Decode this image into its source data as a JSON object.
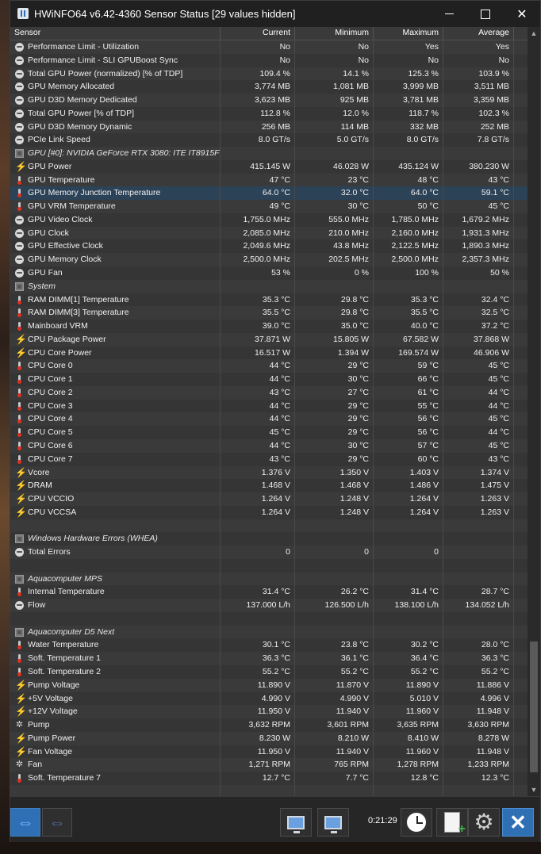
{
  "window": {
    "title": "HWiNFO64 v6.42-4360 Sensor Status [29 values hidden]"
  },
  "columns": {
    "sensor": "Sensor",
    "current": "Current",
    "minimum": "Minimum",
    "maximum": "Maximum",
    "average": "Average"
  },
  "rows": [
    {
      "type": "data",
      "icon": "clock-icon",
      "name": "Performance Limit - Utilization",
      "cur": "No",
      "min": "No",
      "max": "Yes",
      "avg": "Yes"
    },
    {
      "type": "data",
      "icon": "clock-icon",
      "name": "Performance Limit - SLI GPUBoost Sync",
      "cur": "No",
      "min": "No",
      "max": "No",
      "avg": "No"
    },
    {
      "type": "data",
      "icon": "clock-icon",
      "name": "Total GPU Power (normalized) [% of TDP]",
      "cur": "109.4 %",
      "min": "14.1 %",
      "max": "125.3 %",
      "avg": "103.9 %"
    },
    {
      "type": "data",
      "icon": "clock-icon",
      "name": "GPU Memory Allocated",
      "cur": "3,774 MB",
      "min": "1,081 MB",
      "max": "3,999 MB",
      "avg": "3,511 MB"
    },
    {
      "type": "data",
      "icon": "clock-icon",
      "name": "GPU D3D Memory Dedicated",
      "cur": "3,623 MB",
      "min": "925 MB",
      "max": "3,781 MB",
      "avg": "3,359 MB"
    },
    {
      "type": "data",
      "icon": "clock-icon",
      "name": "Total GPU Power [% of TDP]",
      "cur": "112.8 %",
      "min": "12.0 %",
      "max": "118.7 %",
      "avg": "102.3 %"
    },
    {
      "type": "data",
      "icon": "clock-icon",
      "name": "GPU D3D Memory Dynamic",
      "cur": "256 MB",
      "min": "114 MB",
      "max": "332 MB",
      "avg": "252 MB"
    },
    {
      "type": "data",
      "icon": "clock-icon",
      "name": "PCIe Link Speed",
      "cur": "8.0 GT/s",
      "min": "5.0 GT/s",
      "max": "8.0 GT/s",
      "avg": "7.8 GT/s"
    },
    {
      "type": "group",
      "icon": "chip-icon",
      "name": "GPU [#0]: NVIDIA GeForce RTX 3080: ITE IT8915FN"
    },
    {
      "type": "data",
      "icon": "bolt-icon",
      "name": "GPU Power",
      "cur": "415.145 W",
      "min": "46.028 W",
      "max": "435.124 W",
      "avg": "380.230 W"
    },
    {
      "type": "data",
      "icon": "thermometer-icon",
      "name": "GPU Temperature",
      "cur": "47 °C",
      "min": "23 °C",
      "max": "48 °C",
      "avg": "43 °C"
    },
    {
      "type": "data",
      "icon": "thermometer-icon",
      "name": "GPU Memory Junction Temperature",
      "cur": "64.0 °C",
      "min": "32.0 °C",
      "max": "64.0 °C",
      "avg": "59.1 °C",
      "selected": true
    },
    {
      "type": "data",
      "icon": "thermometer-icon",
      "name": "GPU VRM Temperature",
      "cur": "49 °C",
      "min": "30 °C",
      "max": "50 °C",
      "avg": "45 °C"
    },
    {
      "type": "data",
      "icon": "clock-icon",
      "name": "GPU Video Clock",
      "cur": "1,755.0 MHz",
      "min": "555.0 MHz",
      "max": "1,785.0 MHz",
      "avg": "1,679.2 MHz"
    },
    {
      "type": "data",
      "icon": "clock-icon",
      "name": "GPU Clock",
      "cur": "2,085.0 MHz",
      "min": "210.0 MHz",
      "max": "2,160.0 MHz",
      "avg": "1,931.3 MHz"
    },
    {
      "type": "data",
      "icon": "clock-icon",
      "name": "GPU Effective Clock",
      "cur": "2,049.6 MHz",
      "min": "43.8 MHz",
      "max": "2,122.5 MHz",
      "avg": "1,890.3 MHz"
    },
    {
      "type": "data",
      "icon": "clock-icon",
      "name": "GPU Memory Clock",
      "cur": "2,500.0 MHz",
      "min": "202.5 MHz",
      "max": "2,500.0 MHz",
      "avg": "2,357.3 MHz"
    },
    {
      "type": "data",
      "icon": "clock-icon",
      "name": "GPU Fan",
      "cur": "53 %",
      "min": "0 %",
      "max": "100 %",
      "avg": "50 %"
    },
    {
      "type": "group",
      "icon": "chip-icon",
      "name": "System"
    },
    {
      "type": "data",
      "icon": "thermometer-icon",
      "name": "RAM DIMM[1] Temperature",
      "cur": "35.3 °C",
      "min": "29.8 °C",
      "max": "35.3 °C",
      "avg": "32.4 °C"
    },
    {
      "type": "data",
      "icon": "thermometer-icon",
      "name": "RAM DIMM[3] Temperature",
      "cur": "35.5 °C",
      "min": "29.8 °C",
      "max": "35.5 °C",
      "avg": "32.5 °C"
    },
    {
      "type": "data",
      "icon": "thermometer-icon",
      "name": "Mainboard VRM",
      "cur": "39.0 °C",
      "min": "35.0 °C",
      "max": "40.0 °C",
      "avg": "37.2 °C"
    },
    {
      "type": "data",
      "icon": "bolt-icon",
      "name": "CPU Package Power",
      "cur": "37.871 W",
      "min": "15.805 W",
      "max": "67.582 W",
      "avg": "37.868 W"
    },
    {
      "type": "data",
      "icon": "bolt-icon",
      "name": "CPU Core Power",
      "cur": "16.517 W",
      "min": "1.394 W",
      "max": "169.574 W",
      "avg": "46.906 W"
    },
    {
      "type": "data",
      "icon": "thermometer-icon",
      "name": "CPU Core 0",
      "cur": "44 °C",
      "min": "29 °C",
      "max": "59 °C",
      "avg": "45 °C"
    },
    {
      "type": "data",
      "icon": "thermometer-icon",
      "name": "CPU Core 1",
      "cur": "44 °C",
      "min": "30 °C",
      "max": "66 °C",
      "avg": "45 °C"
    },
    {
      "type": "data",
      "icon": "thermometer-icon",
      "name": "CPU Core 2",
      "cur": "43 °C",
      "min": "27 °C",
      "max": "61 °C",
      "avg": "44 °C"
    },
    {
      "type": "data",
      "icon": "thermometer-icon",
      "name": "CPU Core 3",
      "cur": "44 °C",
      "min": "29 °C",
      "max": "55 °C",
      "avg": "44 °C"
    },
    {
      "type": "data",
      "icon": "thermometer-icon",
      "name": "CPU Core 4",
      "cur": "44 °C",
      "min": "29 °C",
      "max": "56 °C",
      "avg": "45 °C"
    },
    {
      "type": "data",
      "icon": "thermometer-icon",
      "name": "CPU Core 5",
      "cur": "45 °C",
      "min": "29 °C",
      "max": "56 °C",
      "avg": "44 °C"
    },
    {
      "type": "data",
      "icon": "thermometer-icon",
      "name": "CPU Core 6",
      "cur": "44 °C",
      "min": "30 °C",
      "max": "57 °C",
      "avg": "45 °C"
    },
    {
      "type": "data",
      "icon": "thermometer-icon",
      "name": "CPU Core 7",
      "cur": "43 °C",
      "min": "29 °C",
      "max": "60 °C",
      "avg": "43 °C"
    },
    {
      "type": "data",
      "icon": "bolt-icon",
      "name": "Vcore",
      "cur": "1.376 V",
      "min": "1.350 V",
      "max": "1.403 V",
      "avg": "1.374 V"
    },
    {
      "type": "data",
      "icon": "bolt-icon",
      "name": "DRAM",
      "cur": "1.468 V",
      "min": "1.468 V",
      "max": "1.486 V",
      "avg": "1.475 V"
    },
    {
      "type": "data",
      "icon": "bolt-icon",
      "name": "CPU VCCIO",
      "cur": "1.264 V",
      "min": "1.248 V",
      "max": "1.264 V",
      "avg": "1.263 V"
    },
    {
      "type": "data",
      "icon": "bolt-icon",
      "name": "CPU VCCSA",
      "cur": "1.264 V",
      "min": "1.248 V",
      "max": "1.264 V",
      "avg": "1.263 V"
    },
    {
      "type": "blank"
    },
    {
      "type": "group",
      "icon": "chip-icon",
      "name": "Windows Hardware Errors (WHEA)"
    },
    {
      "type": "data",
      "icon": "clock-icon",
      "name": "Total Errors",
      "cur": "0",
      "min": "0",
      "max": "0",
      "avg": ""
    },
    {
      "type": "blank"
    },
    {
      "type": "group",
      "icon": "chip-icon",
      "name": "Aquacomputer MPS"
    },
    {
      "type": "data",
      "icon": "thermometer-icon",
      "name": "Internal Temperature",
      "cur": "31.4 °C",
      "min": "26.2 °C",
      "max": "31.4 °C",
      "avg": "28.7 °C"
    },
    {
      "type": "data",
      "icon": "clock-icon",
      "name": "Flow",
      "cur": "137.000 L/h",
      "min": "126.500 L/h",
      "max": "138.100 L/h",
      "avg": "134.052 L/h"
    },
    {
      "type": "blank"
    },
    {
      "type": "group",
      "icon": "chip-icon",
      "name": "Aquacomputer D5 Next"
    },
    {
      "type": "data",
      "icon": "thermometer-icon",
      "name": "Water Temperature",
      "cur": "30.1 °C",
      "min": "23.8 °C",
      "max": "30.2 °C",
      "avg": "28.0 °C"
    },
    {
      "type": "data",
      "icon": "thermometer-icon",
      "name": "Soft. Temperature 1",
      "cur": "36.3 °C",
      "min": "36.1 °C",
      "max": "36.4 °C",
      "avg": "36.3 °C"
    },
    {
      "type": "data",
      "icon": "thermometer-icon",
      "name": "Soft. Temperature 2",
      "cur": "55.2 °C",
      "min": "55.2 °C",
      "max": "55.2 °C",
      "avg": "55.2 °C"
    },
    {
      "type": "data",
      "icon": "bolt-icon",
      "name": "Pump Voltage",
      "cur": "11.890 V",
      "min": "11.870 V",
      "max": "11.890 V",
      "avg": "11.886 V"
    },
    {
      "type": "data",
      "icon": "bolt-icon",
      "name": "+5V Voltage",
      "cur": "4.990 V",
      "min": "4.990 V",
      "max": "5.010 V",
      "avg": "4.996 V"
    },
    {
      "type": "data",
      "icon": "bolt-icon",
      "name": "+12V Voltage",
      "cur": "11.950 V",
      "min": "11.940 V",
      "max": "11.960 V",
      "avg": "11.948 V"
    },
    {
      "type": "data",
      "icon": "fan-icon",
      "name": "Pump",
      "cur": "3,632 RPM",
      "min": "3,601 RPM",
      "max": "3,635 RPM",
      "avg": "3,630 RPM"
    },
    {
      "type": "data",
      "icon": "bolt-icon",
      "name": "Pump Power",
      "cur": "8.230 W",
      "min": "8.210 W",
      "max": "8.410 W",
      "avg": "8.278 W"
    },
    {
      "type": "data",
      "icon": "bolt-icon",
      "name": "Fan Voltage",
      "cur": "11.950 V",
      "min": "11.940 V",
      "max": "11.960 V",
      "avg": "11.948 V"
    },
    {
      "type": "data",
      "icon": "fan-icon",
      "name": "Fan",
      "cur": "1,271 RPM",
      "min": "765 RPM",
      "max": "1,278 RPM",
      "avg": "1,233 RPM"
    },
    {
      "type": "data",
      "icon": "thermometer-icon",
      "name": "Soft. Temperature 7",
      "cur": "12.7 °C",
      "min": "7.7 °C",
      "max": "12.8 °C",
      "avg": "12.3 °C"
    },
    {
      "type": "blank"
    }
  ],
  "toolbar": {
    "timer": "0:21:29",
    "accent": "#2f6fb4"
  }
}
